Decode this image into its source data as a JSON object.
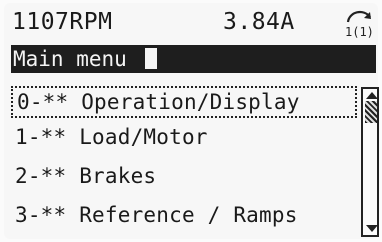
{
  "status": {
    "speed": "1107RPM",
    "current": "3.84A",
    "setup_icon": "setup-indicator-icon",
    "setup_label": "1(1)"
  },
  "title": "Main menu",
  "menu": {
    "items": [
      {
        "label": "0-** Operation/Display",
        "selected": true
      },
      {
        "label": "1-** Load/Motor",
        "selected": false
      },
      {
        "label": "2-** Brakes",
        "selected": false
      },
      {
        "label": "3-** Reference / Ramps",
        "selected": false
      }
    ]
  },
  "colors": {
    "background": "#fbfbfb",
    "text": "#1a1a1a",
    "title_bar": "#1e1e1e"
  }
}
